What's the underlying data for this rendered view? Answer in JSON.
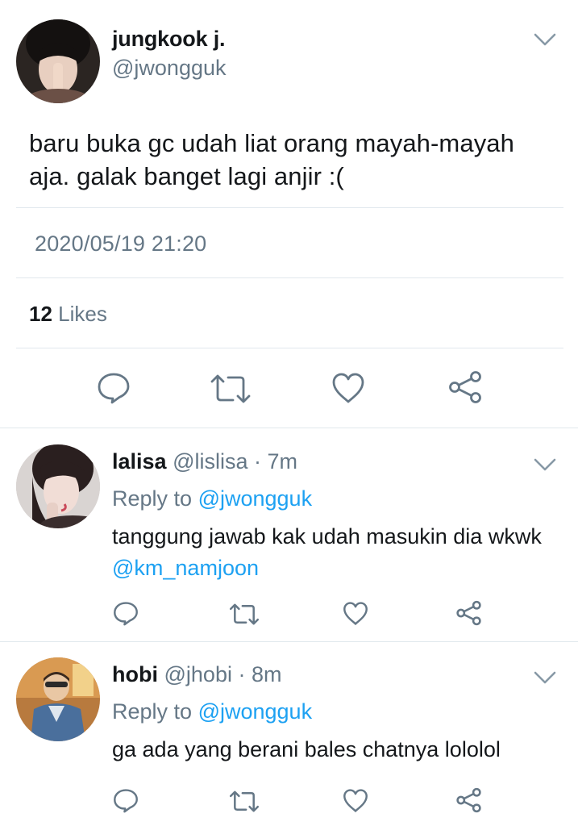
{
  "main_tweet": {
    "display_name": "jungkook j.",
    "handle": "@jwongguk",
    "text_line1": "baru buka gc udah liat orang mayah-mayah",
    "text_line2": "aja.  galak banget lagi anjir :(",
    "timestamp": "2020/05/19 21:20",
    "likes_count": "12",
    "likes_label": "Likes",
    "actions": [
      "reply-icon",
      "retweet-icon",
      "like-icon",
      "share-icon"
    ]
  },
  "replies": [
    {
      "display_name": "lalisa",
      "handle": "@lislisa",
      "separator": "·",
      "time": "7m",
      "reply_to_label": "Reply to",
      "reply_to_handle": "@jwongguk",
      "text_line1": "tanggung jawab kak udah masukin dia wkwk",
      "mention": "@km_namjoon"
    },
    {
      "display_name": "hobi",
      "handle": "@jhobi",
      "separator": "·",
      "time": "8m",
      "reply_to_label": "Reply to",
      "reply_to_handle": "@jwongguk",
      "text_line1": "ga ada yang berani bales chatnya lololol"
    }
  ],
  "colors": {
    "text_primary": "#14171a",
    "text_secondary": "#657786",
    "link": "#1da1f2",
    "divider": "#e1e8ed",
    "icon": "#657786"
  }
}
